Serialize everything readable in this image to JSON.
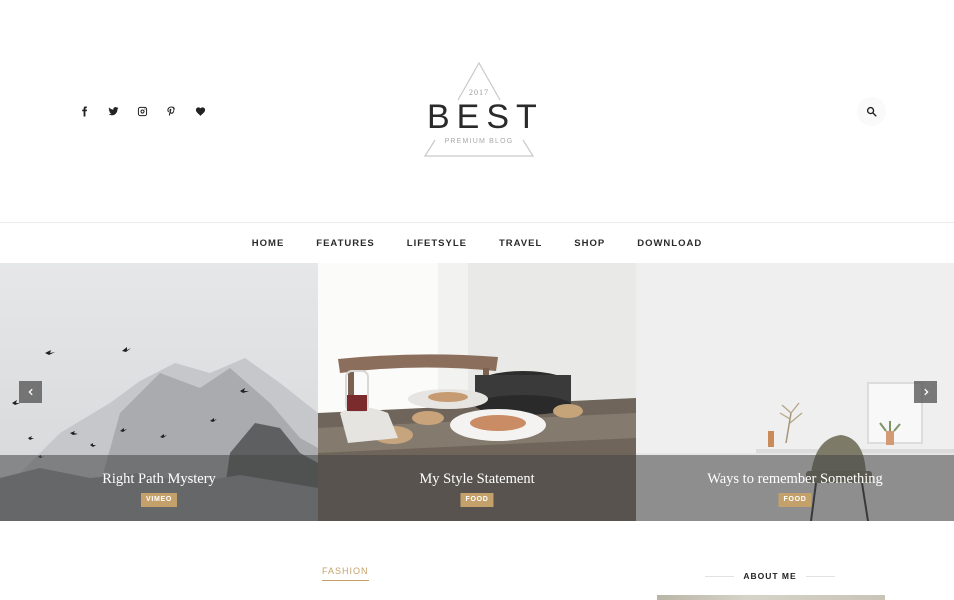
{
  "header": {
    "socials": [
      "facebook-icon",
      "twitter-icon",
      "instagram-icon",
      "pinterest-icon",
      "heart-icon"
    ],
    "logo": {
      "year": "2017",
      "title": "BEST",
      "subtitle": "PREMIUM BLOG"
    },
    "search_icon": "search-icon"
  },
  "nav": {
    "items": [
      "HOME",
      "FEATURES",
      "LIFETSYLE",
      "TRAVEL",
      "SHOP",
      "DOWNLOAD"
    ]
  },
  "slider": {
    "slides": [
      {
        "title": "Right Path Mystery",
        "tag": "VIMEO"
      },
      {
        "title": "My Style Statement",
        "tag": "FOOD"
      },
      {
        "title": "Ways to remember Something",
        "tag": "FOOD"
      }
    ],
    "prev_icon": "chevron-left-icon",
    "next_icon": "chevron-right-icon"
  },
  "main": {
    "category_label": "FASHION"
  },
  "sidebar": {
    "about_title": "ABOUT ME"
  },
  "colors": {
    "accent": "#c4a16b",
    "text": "#222222",
    "overlay": "#464646"
  }
}
